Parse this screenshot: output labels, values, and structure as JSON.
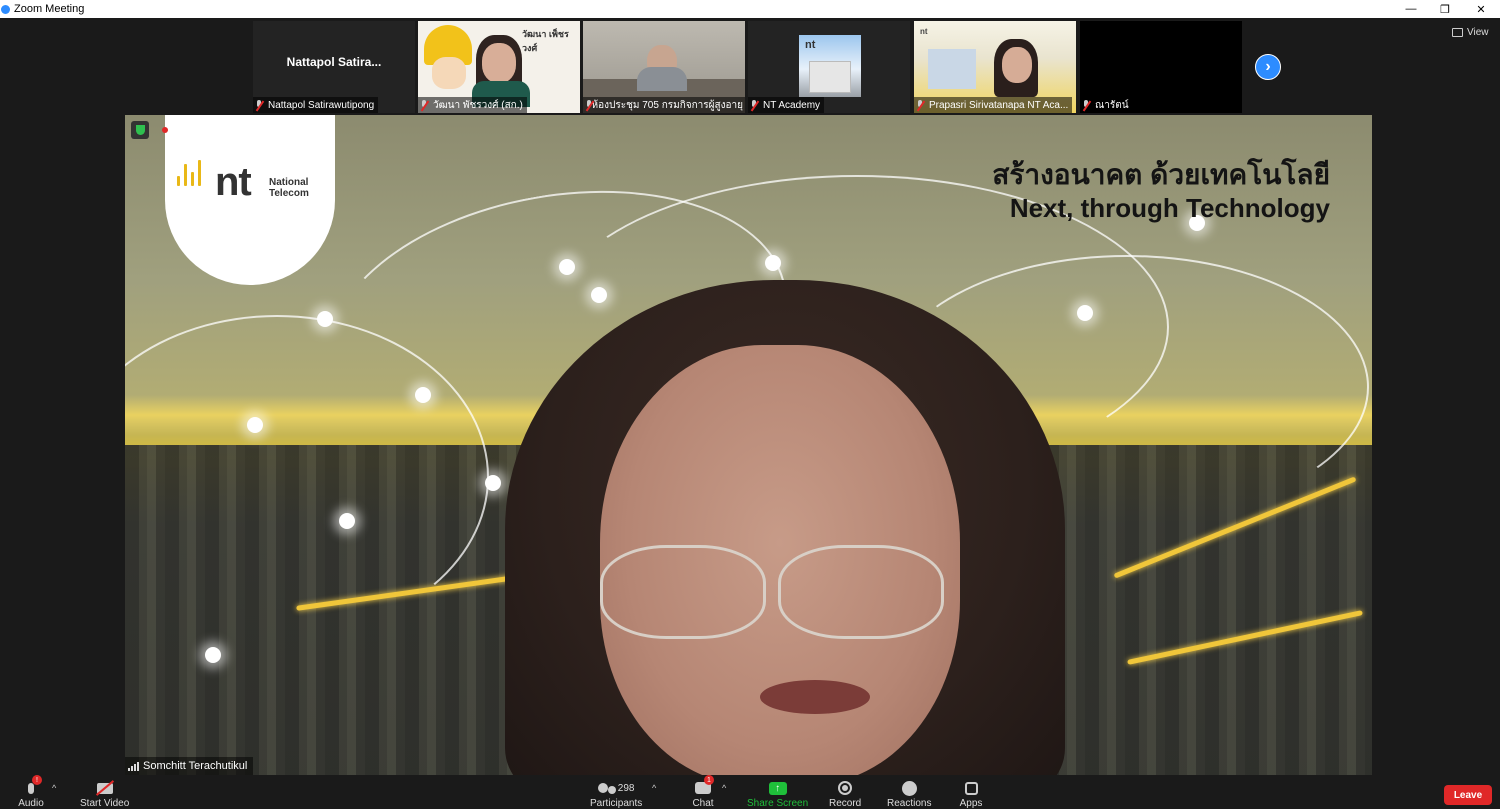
{
  "window": {
    "title": "Zoom Meeting",
    "controls": {
      "minimize": "—",
      "restore": "❐",
      "close": "✕"
    }
  },
  "view_button": {
    "label": "View"
  },
  "participants_strip": [
    {
      "display": "name",
      "big_name": "Nattapol  Satira...",
      "label": "Nattapol Satirawutipong"
    },
    {
      "display": "video",
      "label": "วัฒนา พัชรวงศ์ (สก.)",
      "overlay_text": "วัฒนา เพ็ชรวงศ์"
    },
    {
      "display": "video",
      "label": "ห้องประชุม 705 กรมกิจการผู้สูงอายุ"
    },
    {
      "display": "logo",
      "label": "NT Academy"
    },
    {
      "display": "video",
      "label": "Prapasri  Sirivatanapa NT Aca..."
    },
    {
      "display": "blank",
      "label": "ณารัตน์"
    }
  ],
  "next_page_icon": "chevron-right-icon",
  "main_video": {
    "logo_mark": "nt",
    "logo_sub_1": "National",
    "logo_sub_2": "Telecom",
    "headline_th": "สร้างอนาคต ด้วยเทคโนโลยี",
    "headline_en": "Next, through Technology",
    "speaker_name": "Somchitt Terachutikul"
  },
  "toolbar": {
    "audio_label": "Audio",
    "audio_badge": "!",
    "start_video_label": "Start Video",
    "participants_label": "Participants",
    "participants_count": "298",
    "chat_label": "Chat",
    "chat_badge": "1",
    "share_label": "Share Screen",
    "record_label": "Record",
    "reactions_label": "Reactions",
    "apps_label": "Apps",
    "leave_label": "Leave",
    "caret": "^"
  },
  "colors": {
    "zoom_blue": "#2d8cff",
    "share_green": "#1fbf3a",
    "leave_red": "#e02828",
    "nt_yellow": "#e9b817"
  }
}
